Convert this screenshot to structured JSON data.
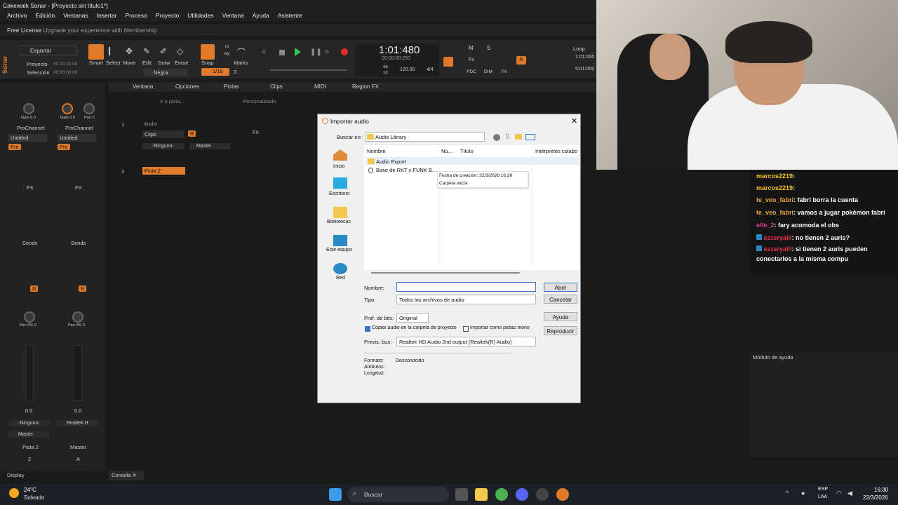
{
  "window": {
    "title": "Cakewalk Sonar - [Proyecto sin título1*]"
  },
  "menu": [
    "Archivo",
    "Edición",
    "Ventanas",
    "Insertar",
    "Proceso",
    "Proyecto",
    "Utilidades",
    "Ventana",
    "Ayuda",
    "Asistente"
  ],
  "license": {
    "free": "Free License",
    "upgrade": "Upgrade your experience with Membership"
  },
  "toolbar": {
    "export": "Exportar",
    "proyecto": "Proyecto",
    "seleccion": "Selección",
    "time0": "00:00:00:00",
    "time1": "00:00:00:00",
    "tools": [
      "Smart",
      "Select",
      "Move",
      "Edit",
      "Draw",
      "Erase"
    ],
    "snap": "Snap",
    "snap_val": "1/16",
    "snap_num": "3",
    "to": "To",
    "by": "By",
    "marks": "Marks",
    "negra": "Negra",
    "time_main": "1:01:480",
    "time_sub": "00:00:00:250",
    "tempo": "120.00",
    "meter": "4/4",
    "beats_top": "48",
    "beats_bot": "16",
    "loop": "Loop",
    "loop_start": "1:01:000",
    "loop_end": "5:01:000",
    "mixletters": [
      "M",
      "S",
      "R",
      "Fx",
      "PDC",
      "DIM",
      "Px"
    ]
  },
  "trackview_menu": [
    "Ventana",
    "Opciones",
    "Pistas",
    "Clips",
    "MIDI",
    "Region FX"
  ],
  "trackview": {
    "custom": "Personalizado",
    "goto": "Ir a pista..."
  },
  "tracks": [
    {
      "num": "1",
      "name": "Audio",
      "clips": "Clips",
      "input": "-Ninguno-",
      "out": "Master",
      "fx": "FX"
    },
    {
      "num": "2",
      "name": "Pista 2"
    }
  ],
  "inspector": {
    "gain": "Gain 0.0",
    "pan": "Pan C",
    "gain2": "Gain 0.0",
    "pan2": "Pan C",
    "prochannel": "ProChannel",
    "untitled": "Untitled",
    "pre": "Pre",
    "fx": "FX",
    "sends": "Sends",
    "panlabel": "Pan 0% C",
    "vol": "0.0",
    "strip1_in": "-Ninguno-",
    "strip1_out": "Master",
    "strip2_in": "Realtek H",
    "strip1_name": "Pista 2",
    "strip1_num": "2",
    "strip2_name": "Master",
    "strip2_num": "A",
    "display": "Display",
    "console": "Consola"
  },
  "dialog": {
    "title": "Importar audio",
    "buscar_en_label": "Buscar en:",
    "buscar_en": "Audio Library",
    "places": [
      "Inicio",
      "Escritorio",
      "Bibliotecas",
      "Este equipo",
      "Red"
    ],
    "cols": [
      "Nombre",
      "Nú...",
      "Título",
      "Intérpretes colabo"
    ],
    "files": [
      "Audio Export",
      "Base de RKT x FUNK B..."
    ],
    "tooltip1": "Fecha de creación: 22/3/2026 16:28",
    "tooltip2": "Carpeta vacía",
    "nombre_label": "Nombre:",
    "tipo_label": "Tipo:",
    "tipo": "Todos los archivos de audio",
    "prof_label": "Prof. de bits:",
    "prof": "Original",
    "copy_chk": "Copiar audio en la carpeta de proyecto",
    "mono_chk": "Importar como pistas mono",
    "bus_label": "Previs. bus:",
    "bus": "Realtek HD Audio 2nd output (Realtek(R) Audio)",
    "formato_label": "Formato:",
    "formato": "Desconocido",
    "atributos_label": "Atributos:",
    "longitud_label": "Longitud:",
    "abrir": "Abrir",
    "cancelar": "Cancelar",
    "ayuda": "Ayuda",
    "reproducir": "Reproducir"
  },
  "chat": [
    {
      "user": "marcos2219",
      "msg": "",
      "color": "#f5c518"
    },
    {
      "user": "marcos2219",
      "msg": "",
      "color": "#f5c518"
    },
    {
      "user": "te_veo_fabri",
      "msg": "fabri borra la cuenta",
      "color": "#e8a23a"
    },
    {
      "user": "te_veo_fabri",
      "msg": "vamos a jugar pokémon fabri",
      "color": "#e8a23a"
    },
    {
      "user": "elfe_2",
      "msg": "fary acomoda el obs",
      "color": "#e03b8f"
    },
    {
      "user": "ezzeryalll",
      "msg": "no tienen 2 auris?",
      "color": "#e0304a"
    },
    {
      "user": "ezzeryalll",
      "msg": "si tienen 2 auris pueden conectarlos a la misma compu",
      "color": "#e0304a"
    }
  ],
  "help_panel": "Módulo de ayuda",
  "taskbar": {
    "weather_temp": "24°C",
    "weather_desc": "Soleado",
    "search": "Buscar",
    "lang1": "ESP",
    "lang2": "LAA",
    "time": "16:30",
    "date": "22/3/2026"
  }
}
